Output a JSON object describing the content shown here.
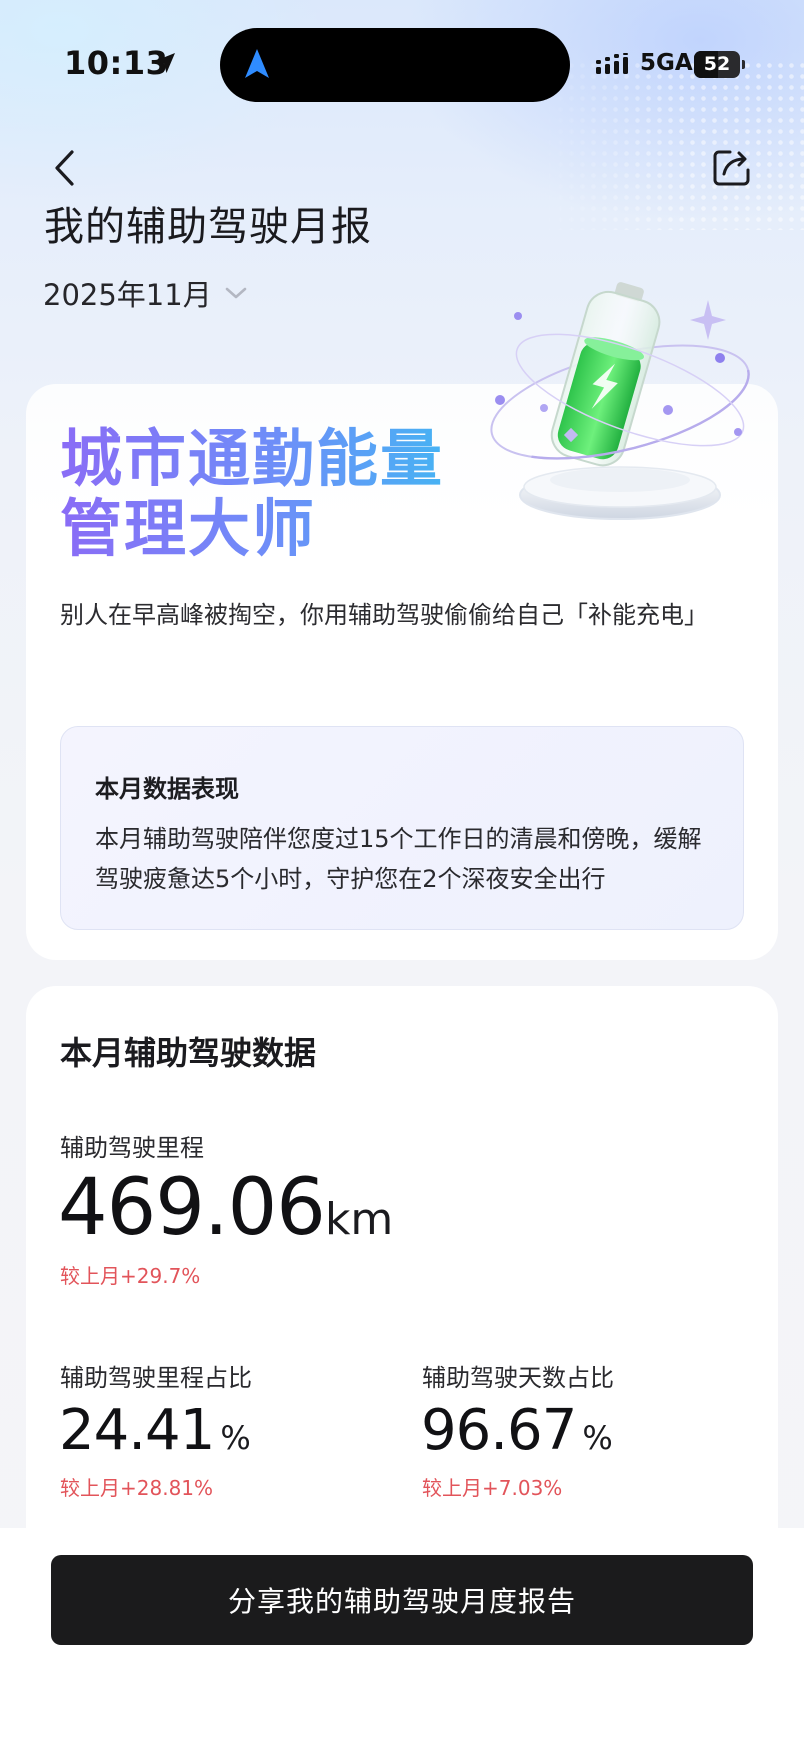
{
  "status_bar": {
    "time": "10:13",
    "network": "5GA",
    "battery": "52"
  },
  "header": {
    "title": "我的辅助驾驶月报",
    "month": "2025年11月"
  },
  "hero": {
    "title_line1": "城市通勤能量",
    "title_line2": "管理大师",
    "description": "别人在早高峰被掏空，你用辅助驾驶偷偷给自己「补能充电」",
    "summary_title": "本月数据表现",
    "summary_text": "本月辅助驾驶陪伴您度过15个工作日的清晨和傍晚，缓解驾驶疲惫达5个小时，守护您在2个深夜安全出行"
  },
  "stats": {
    "title": "本月辅助驾驶数据",
    "mileage": {
      "label": "辅助驾驶里程",
      "value": "469.06",
      "unit": "km",
      "delta": "较上月+29.7%"
    },
    "mileage_ratio": {
      "label": "辅助驾驶里程占比",
      "value": "24.41",
      "unit": "%",
      "delta": "较上月+28.81%"
    },
    "days_ratio": {
      "label": "辅助驾驶天数占比",
      "value": "96.67",
      "unit": "%",
      "delta": "较上月+7.03%"
    }
  },
  "cta": {
    "label": "分享我的辅助驾驶月度报告"
  },
  "colors": {
    "accent_gradient_start": "#8a6cf6",
    "accent_gradient_end": "#43b6f3",
    "delta_red": "#e2545a",
    "cta_bg": "#1b1b1c",
    "battery_green": "#3bd65a"
  }
}
